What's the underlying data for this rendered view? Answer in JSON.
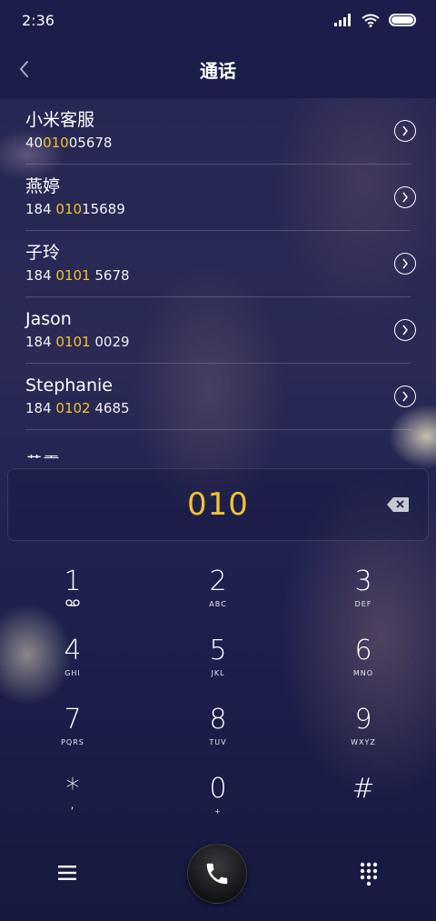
{
  "status_bar": {
    "time": "2:36"
  },
  "header": {
    "title": "通话"
  },
  "contacts": [
    {
      "name": "小米客服",
      "number_pre": "40",
      "number_match": "010",
      "number_post": "05678"
    },
    {
      "name": "燕婷",
      "number_pre": "184 ",
      "number_match": "010",
      "number_post": "15689"
    },
    {
      "name": "子玲",
      "number_pre": "184 ",
      "number_match": "0101",
      "number_post": " 5678"
    },
    {
      "name": "Jason",
      "number_pre": "184 ",
      "number_match": "0101",
      "number_post": " 0029"
    },
    {
      "name": "Stephanie",
      "number_pre": "184 ",
      "number_match": "0102",
      "number_post": " 4685"
    },
    {
      "name": "黄霞",
      "number_pre": "",
      "number_match": "",
      "number_post": ""
    }
  ],
  "dialer": {
    "input_value": "010"
  },
  "keypad": [
    {
      "digit": "1",
      "sub": ""
    },
    {
      "digit": "2",
      "sub": "ABC"
    },
    {
      "digit": "3",
      "sub": "DEF"
    },
    {
      "digit": "4",
      "sub": "GHI"
    },
    {
      "digit": "5",
      "sub": "JKL"
    },
    {
      "digit": "6",
      "sub": "MNO"
    },
    {
      "digit": "7",
      "sub": "PQRS"
    },
    {
      "digit": "8",
      "sub": "TUV"
    },
    {
      "digit": "9",
      "sub": "WXYZ"
    },
    {
      "digit": "*",
      "sub": ","
    },
    {
      "digit": "0",
      "sub": "+"
    },
    {
      "digit": "#",
      "sub": ""
    }
  ],
  "icons": {
    "back": "chevron-left-icon",
    "detail": "chevron-right-circle-icon",
    "backspace": "backspace-icon",
    "menu": "menu-icon",
    "call": "phone-icon",
    "keypad_toggle": "dialpad-icon",
    "voicemail": "voicemail-icon"
  },
  "colors": {
    "match_highlight": "#f2c230",
    "background": "#1c1f4a"
  }
}
